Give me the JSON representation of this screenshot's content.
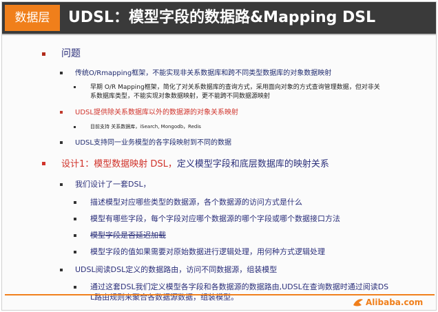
{
  "header": {
    "badge": "数据层",
    "title": "UDSL：模型字段的数据路&Mapping DSL"
  },
  "content": {
    "problem_heading": "问题",
    "problem_items": [
      "传统O/Rmapping框架，不能实现非关系数据库和跨不同类型数据库的对象数据映射",
      "早期 O/R Mapping框架，简化了对关系数据库的查询方式，采用面向对象的方式查询管理数据，但对非关",
      "系数据库类型，不能实现对象数据映射，更不能跨不同数据源映射",
      "UDSL提供除关系数据库以外的数据源的对象关系映射",
      "目前支持 关系数据库，iSearch, Mongodb，Redis",
      "UDSL支持同一业务模型的各字段映射到不同的数据"
    ],
    "design_heading_red": "设计1：模型数据映射 DSL，",
    "design_heading_rest": "定义模型字段和底层数据库的映射关系",
    "design_intro": "我们设计了一套DSL，",
    "design_items": [
      "描述模型对应哪些类型的数据源，各个数据源的访问方式是什么",
      "模型有哪些字段，每个字段对应哪个数据源的哪个字段或哪个数据接口方法",
      "模型字段是否延迟加载",
      "模型字段的值如果需要对原始数据进行逻辑处理，用何种方式逻辑处理"
    ],
    "udsl_read": "UDSL阅读DSL定义的数据路由，访问不同数据源，组装模型",
    "udsl_detail_1": "通过这套DSL我们定义模型各字段和各数据源的数据路由,UDSL在查询数据时通过阅读DS",
    "udsl_detail_2": "L路由规则来聚合各数据源数据，组装模型。"
  },
  "footer": {
    "logo": "Alibaba.com"
  },
  "colors": {
    "accent": "#f07f1b",
    "header_bg": "#3a3a3a",
    "red": "#d0322a",
    "navy": "#2b2f7a"
  }
}
